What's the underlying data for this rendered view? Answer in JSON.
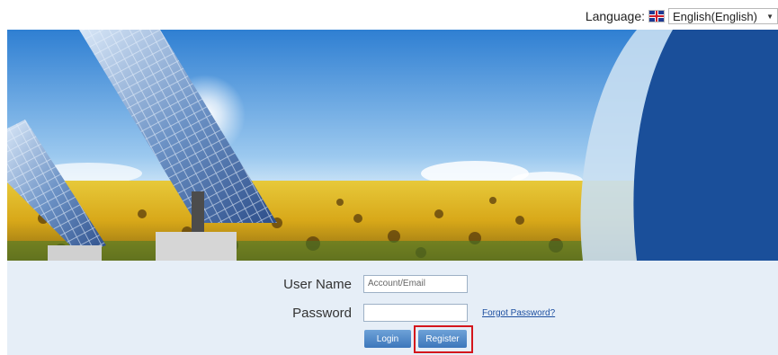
{
  "language": {
    "label": "Language:",
    "selected": "English(English)",
    "flag_icon": "uk-flag-icon"
  },
  "login": {
    "username_label": "User Name",
    "username_placeholder": "Account/Email",
    "password_label": "Password",
    "password_value": "",
    "forgot_password": "Forgot Password?",
    "login_button": "Login",
    "register_button": "Register"
  },
  "colors": {
    "login_bg": "#e6eef7",
    "button_blue": "#3c76bb",
    "highlight_red": "#d4161c",
    "sky_blue": "#4a90d9",
    "banner_dark_blue": "#1a4f9a"
  }
}
